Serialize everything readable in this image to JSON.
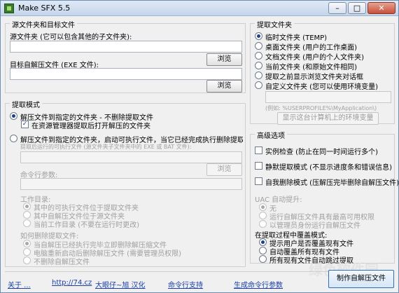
{
  "window": {
    "title": "Make SFX 5.5",
    "minimize": "–",
    "maximize": "□",
    "close": "✕"
  },
  "source": {
    "group_title": "源文件夹和目标文件",
    "folder_label": "源文件夹 (它可以包含其他的子文件夹):",
    "folder_value": "",
    "browse1": "浏览",
    "target_label": "目标自解压文件 (EXE 文件):",
    "target_value": "",
    "browse2": "浏览"
  },
  "extract_mode": {
    "group_title": "提取模式",
    "opt1": "解压文件到指定的文件夹 - 不删除提取文件",
    "opt1_check": "在资源管理器提取后打开解压的文件夹",
    "opt2": "解压文件到指定的文件夹，启动可执行文件，当它已经完成执行删除提取的文件",
    "exe_label": "提取后运行的可执行文件 (源文件夹子文件夹中的 EXE 或 BAT 文件):",
    "exe_value": "",
    "browse3": "浏览",
    "cmd_label": "命令行参数:",
    "cmd_value": "",
    "workdir_label": "工作目录:",
    "workdir_opt1": "其中的可执行文件位于提取文件夹",
    "workdir_opt2": "其中自解压文件位于源文件夹",
    "workdir_opt3": "当前工作目录 (不要在运行时更改)",
    "del_label": "如何删除提取文件:",
    "del_opt1": "当自解压已经执行完毕立即删除解压缩文件",
    "del_opt2": "电脑重新启动后删除解压文件 (需要管理员权限)",
    "del_opt3": "不删除自解压文件"
  },
  "extract_folder": {
    "group_title": "提取文件夹",
    "opt1": "临时文件夹 (TEMP)",
    "opt2": "桌面文件夹 (用户的工作桌面)",
    "opt3": "文档文件夹 (用户的个人文件夹)",
    "opt4": "当前文件夹 (和原始文件相同)",
    "opt5": "提取之前显示浏览文件夹对话框",
    "opt6": "自定义文件夹 (您可以使用环境变量)",
    "custom_value": "",
    "example": "(例如: %USERPROFILE%\\MyApplication\\)",
    "env_button": "显示这台计算机上的环境变量"
  },
  "advanced": {
    "group_title": "高级选项",
    "chk1": "实例检查 (防止在同一时间运行多个)",
    "chk2": "静默提取模式 (不显示进度条和错误信息)",
    "chk3": "自我删除模式 (压解压完毕删除自解压文件)",
    "uac_label": "UAC 自动提升:",
    "uac_opt1": "无",
    "uac_opt2": "运行自解压文件具有最高可用权限",
    "uac_opt3": "以管理员身份运行自解压文件",
    "overwrite_label": "在提取过程中覆盖模式:",
    "ow_opt1": "提示用户是否覆盖现有文件",
    "ow_opt2": "自动覆盖所有现有文件",
    "ow_opt3": "所有现有文件自动跳过提取"
  },
  "footer": {
    "about": "关于 ...",
    "url": "http://74.cz",
    "translator": "大眼仔~旭 汉化",
    "cmd_support": "命令行支持",
    "gen_cmd": "生成命令行参数",
    "create_button": "制作自解压文件"
  },
  "watermark": "绿色软件园"
}
